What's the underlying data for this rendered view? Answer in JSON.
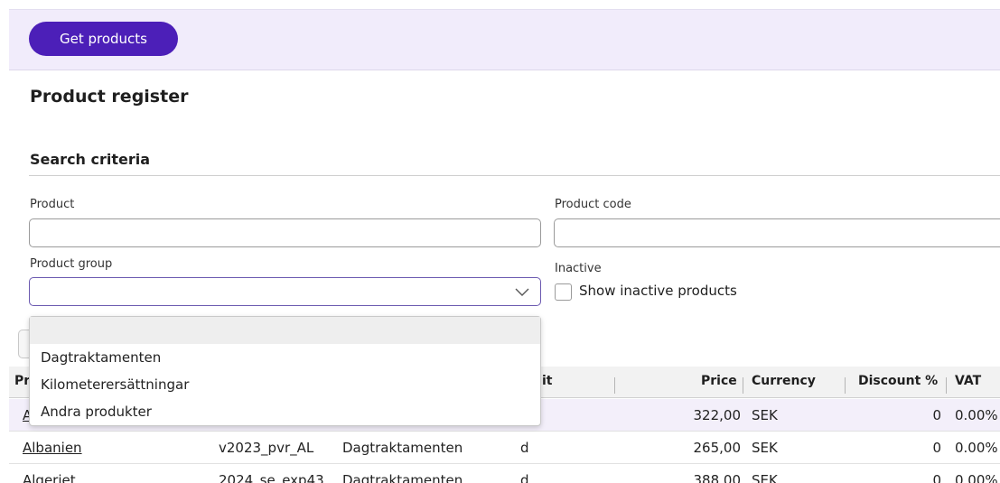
{
  "toolbar": {
    "get_products_label": "Get products"
  },
  "page": {
    "title": "Product register",
    "section_title": "Search criteria"
  },
  "search": {
    "product_label": "Product",
    "product_value": "",
    "product_code_label": "Product code",
    "product_code_value": "",
    "product_group_label": "Product group",
    "product_group_value": "",
    "inactive_label": "Inactive",
    "show_inactive_label": "Show inactive products",
    "show_inactive_checked": false
  },
  "dropdown": {
    "options": [
      "",
      "Dagtraktamenten",
      "Kilometerersättningar",
      "Andra produkter"
    ]
  },
  "table": {
    "headers": {
      "product": "Pr",
      "unit": "it",
      "price": "Price",
      "currency": "Currency",
      "discount": "Discount %",
      "vat": "VAT"
    },
    "rows": [
      {
        "product": "A",
        "code": "",
        "group": "",
        "unit": "",
        "price": "322,00",
        "currency": "SEK",
        "discount": "0",
        "vat": "0.00%"
      },
      {
        "product": "Albanien",
        "code": "v2023_pvr_AL",
        "group": "Dagtraktamenten",
        "unit": "d",
        "price": "265,00",
        "currency": "SEK",
        "discount": "0",
        "vat": "0.00%"
      },
      {
        "product": "Algeriet",
        "code": "2024_se_exp43",
        "group": "Dagtraktamenten",
        "unit": "d",
        "price": "388,00",
        "currency": "SEK",
        "discount": "0",
        "vat": "0.00%"
      }
    ]
  },
  "colors": {
    "accent": "#4c1fb8",
    "topbar_bg": "#f1ecfb",
    "row_highlight": "#f3effa"
  }
}
